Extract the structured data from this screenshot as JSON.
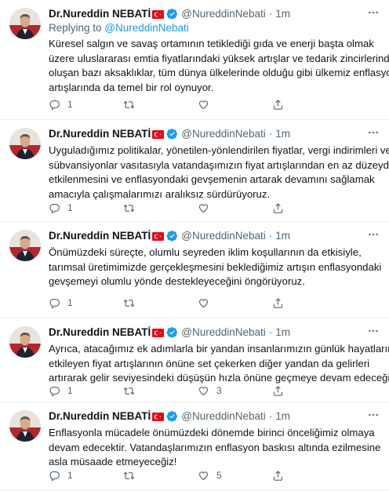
{
  "colors": {
    "accent": "#1d9bf0",
    "muted": "#536471",
    "text": "#0f1419",
    "flag_red": "#e30a17"
  },
  "icons": {
    "avatar": "avatar-photo",
    "flag": "turkey-flag-icon",
    "verified": "verified-badge-icon",
    "more": "more-dots-icon",
    "reply": "reply-icon",
    "retweet": "retweet-icon",
    "like": "heart-icon",
    "share": "share-icon"
  },
  "tweets": [
    {
      "name": "Dr.Nureddin NEBATİ",
      "handle": "@NureddinNebati",
      "dot": "·",
      "time": "1m",
      "reply_prefix": "Replying to ",
      "reply_handle": "@NureddinNebati",
      "lines": [
        "Küresel salgın ve savaş ortamının tetiklediği gıda ve enerji başta olmak",
        "üzere uluslararası emtia fiyatlarındaki yüksek artışlar ve tedarik zincirlerinde",
        "oluşan bazı aksaklıklar, tüm dünya ülkelerinde olduğu gibi ülkemiz enflasyon",
        "artışlarında da temel bir rol oynuyor."
      ],
      "reply_count": "1",
      "retweet_count": "",
      "like_count": ""
    },
    {
      "name": "Dr.Nureddin NEBATİ",
      "handle": "@NureddinNebati",
      "dot": "·",
      "time": "1m",
      "lines": [
        "Uyguladığımız politikalar, yönetilen-yönlendirilen fiyatlar, vergi indirimleri ve",
        "sübvansiyonlar vasıtasıyla vatandaşımızın fiyat artışlarından en az düzeyde",
        "etkilenmesini ve enflasyondaki gevşemenin artarak devamını sağlamak",
        "amacıyla çalışmalarımızı aralıksız sürdürüyoruz."
      ],
      "reply_count": "1",
      "retweet_count": "",
      "like_count": ""
    },
    {
      "name": "Dr.Nureddin NEBATİ",
      "handle": "@NureddinNebati",
      "dot": "·",
      "time": "1m",
      "lines": [
        "Önümüzdeki süreçte, olumlu seyreden iklim koşullarının da etkisiyle,",
        "tarımsal üretimimizde gerçekleşmesini beklediğimiz artışın enflasyondaki",
        "gevşemeyi olumlu yönde destekleyeceğini öngörüyoruz."
      ],
      "reply_count": "1",
      "retweet_count": "",
      "like_count": ""
    },
    {
      "name": "Dr.Nureddin NEBATİ",
      "handle": "@NureddinNebati",
      "dot": "·",
      "time": "1m",
      "lines": [
        "Ayrıca, atacağımız ek adımlarla bir yandan insanlarımızın günlük hayatlarını",
        "etkileyen fiyat artışlarının önüne set çekerken diğer yandan da gelirleri",
        "artırarak gelir seviyesindeki düşüşün hızla önüne geçmeye devam edeceğiz."
      ],
      "reply_count": "1",
      "retweet_count": "",
      "like_count": "3"
    },
    {
      "name": "Dr.Nureddin NEBATİ",
      "handle": "@NureddinNebati",
      "dot": "·",
      "time": "1m",
      "lines": [
        "Enflasyonla mücadele önümüzdeki dönemde birinci önceliğimiz olmaya",
        "devam edecektir. Vatandaşlarımızın enflasyon baskısı altında ezilmesine",
        "asla müsaade etmeyeceğiz!"
      ],
      "reply_count": "1",
      "retweet_count": "",
      "like_count": "5"
    }
  ]
}
